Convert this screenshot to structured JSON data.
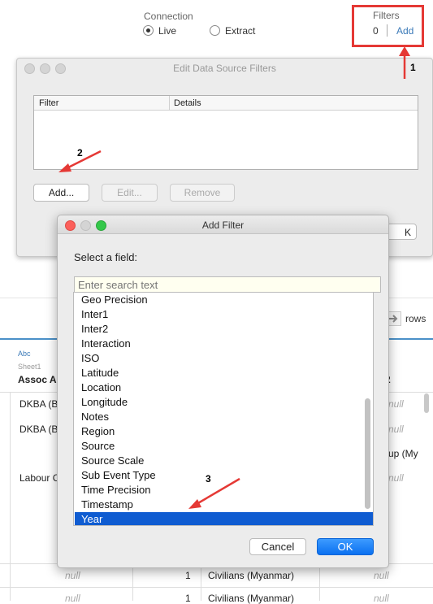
{
  "topbar": {
    "connection_label": "Connection",
    "live_label": "Live",
    "extract_label": "Extract",
    "filters_label": "Filters",
    "filters_count": "0",
    "filters_add": "Add"
  },
  "annotations": {
    "n1": "1",
    "n2": "2",
    "n3": "3"
  },
  "background_table": {
    "rows_label": "rows",
    "col_type": "Abc",
    "col_source": "Sheet1",
    "col_name": "Assoc Ac",
    "col_right_header": "2",
    "cells": [
      "DKBA (B",
      "DKBA (B",
      "Labour C",
      "up (My"
    ],
    "null_label": "null",
    "one_label": "1",
    "civilians": "Civilians (Myanmar)"
  },
  "edit_dialog": {
    "title": "Edit Data Source Filters",
    "col_filter": "Filter",
    "col_details": "Details",
    "add_button": "Add...",
    "edit_button": "Edit...",
    "remove_button": "Remove",
    "ok_partial": "K"
  },
  "add_filter_dialog": {
    "title": "Add Filter",
    "prompt": "Select a field:",
    "search_placeholder": "Enter search text",
    "fields": [
      "Geo Precision",
      "Inter1",
      "Inter2",
      "Interaction",
      "ISO",
      "Latitude",
      "Location",
      "Longitude",
      "Notes",
      "Region",
      "Source",
      "Source Scale",
      "Sub Event Type",
      "Time Precision",
      "Timestamp",
      "Year"
    ],
    "selected_field": "Year",
    "cancel_button": "Cancel",
    "ok_button": "OK"
  },
  "colors": {
    "accent": "#0f5cd1",
    "link": "#3b7ab8",
    "annotation_red": "#e53935"
  }
}
